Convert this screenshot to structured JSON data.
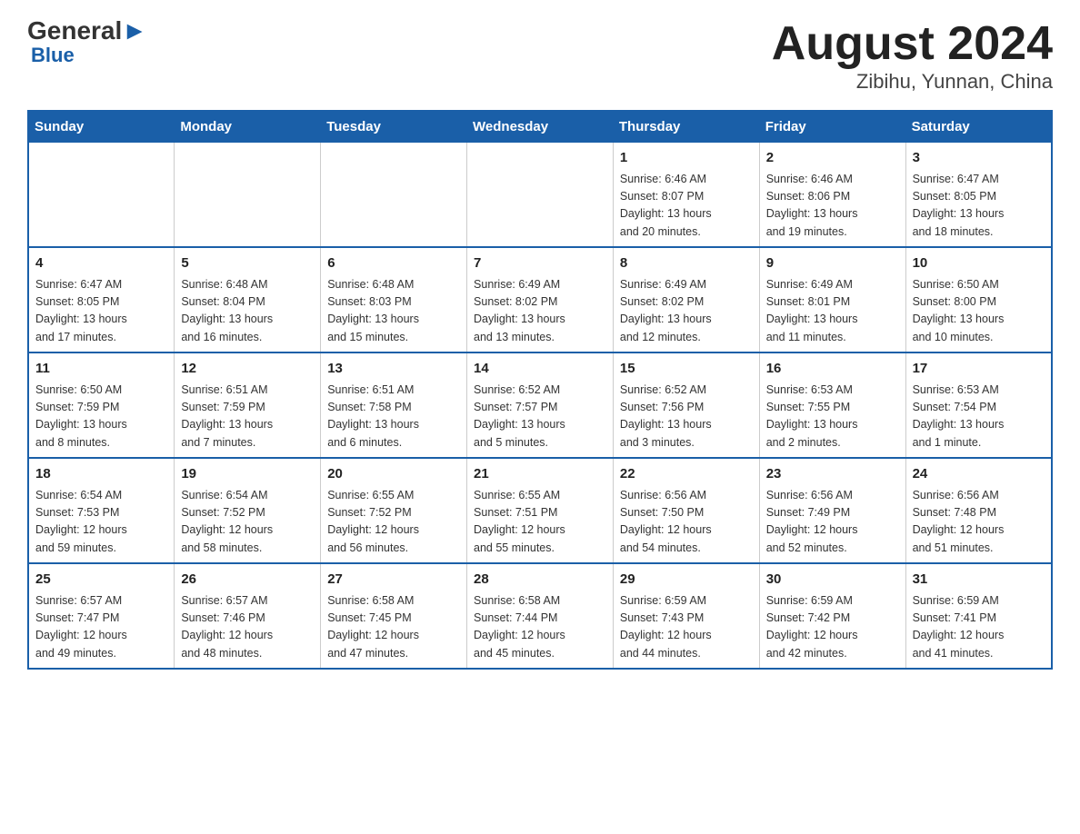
{
  "logo": {
    "general": "General",
    "arrow": "▶",
    "blue": "Blue"
  },
  "title": "August 2024",
  "subtitle": "Zibihu, Yunnan, China",
  "weekdays": [
    "Sunday",
    "Monday",
    "Tuesday",
    "Wednesday",
    "Thursday",
    "Friday",
    "Saturday"
  ],
  "weeks": [
    [
      {
        "day": "",
        "info": ""
      },
      {
        "day": "",
        "info": ""
      },
      {
        "day": "",
        "info": ""
      },
      {
        "day": "",
        "info": ""
      },
      {
        "day": "1",
        "info": "Sunrise: 6:46 AM\nSunset: 8:07 PM\nDaylight: 13 hours\nand 20 minutes."
      },
      {
        "day": "2",
        "info": "Sunrise: 6:46 AM\nSunset: 8:06 PM\nDaylight: 13 hours\nand 19 minutes."
      },
      {
        "day": "3",
        "info": "Sunrise: 6:47 AM\nSunset: 8:05 PM\nDaylight: 13 hours\nand 18 minutes."
      }
    ],
    [
      {
        "day": "4",
        "info": "Sunrise: 6:47 AM\nSunset: 8:05 PM\nDaylight: 13 hours\nand 17 minutes."
      },
      {
        "day": "5",
        "info": "Sunrise: 6:48 AM\nSunset: 8:04 PM\nDaylight: 13 hours\nand 16 minutes."
      },
      {
        "day": "6",
        "info": "Sunrise: 6:48 AM\nSunset: 8:03 PM\nDaylight: 13 hours\nand 15 minutes."
      },
      {
        "day": "7",
        "info": "Sunrise: 6:49 AM\nSunset: 8:02 PM\nDaylight: 13 hours\nand 13 minutes."
      },
      {
        "day": "8",
        "info": "Sunrise: 6:49 AM\nSunset: 8:02 PM\nDaylight: 13 hours\nand 12 minutes."
      },
      {
        "day": "9",
        "info": "Sunrise: 6:49 AM\nSunset: 8:01 PM\nDaylight: 13 hours\nand 11 minutes."
      },
      {
        "day": "10",
        "info": "Sunrise: 6:50 AM\nSunset: 8:00 PM\nDaylight: 13 hours\nand 10 minutes."
      }
    ],
    [
      {
        "day": "11",
        "info": "Sunrise: 6:50 AM\nSunset: 7:59 PM\nDaylight: 13 hours\nand 8 minutes."
      },
      {
        "day": "12",
        "info": "Sunrise: 6:51 AM\nSunset: 7:59 PM\nDaylight: 13 hours\nand 7 minutes."
      },
      {
        "day": "13",
        "info": "Sunrise: 6:51 AM\nSunset: 7:58 PM\nDaylight: 13 hours\nand 6 minutes."
      },
      {
        "day": "14",
        "info": "Sunrise: 6:52 AM\nSunset: 7:57 PM\nDaylight: 13 hours\nand 5 minutes."
      },
      {
        "day": "15",
        "info": "Sunrise: 6:52 AM\nSunset: 7:56 PM\nDaylight: 13 hours\nand 3 minutes."
      },
      {
        "day": "16",
        "info": "Sunrise: 6:53 AM\nSunset: 7:55 PM\nDaylight: 13 hours\nand 2 minutes."
      },
      {
        "day": "17",
        "info": "Sunrise: 6:53 AM\nSunset: 7:54 PM\nDaylight: 13 hours\nand 1 minute."
      }
    ],
    [
      {
        "day": "18",
        "info": "Sunrise: 6:54 AM\nSunset: 7:53 PM\nDaylight: 12 hours\nand 59 minutes."
      },
      {
        "day": "19",
        "info": "Sunrise: 6:54 AM\nSunset: 7:52 PM\nDaylight: 12 hours\nand 58 minutes."
      },
      {
        "day": "20",
        "info": "Sunrise: 6:55 AM\nSunset: 7:52 PM\nDaylight: 12 hours\nand 56 minutes."
      },
      {
        "day": "21",
        "info": "Sunrise: 6:55 AM\nSunset: 7:51 PM\nDaylight: 12 hours\nand 55 minutes."
      },
      {
        "day": "22",
        "info": "Sunrise: 6:56 AM\nSunset: 7:50 PM\nDaylight: 12 hours\nand 54 minutes."
      },
      {
        "day": "23",
        "info": "Sunrise: 6:56 AM\nSunset: 7:49 PM\nDaylight: 12 hours\nand 52 minutes."
      },
      {
        "day": "24",
        "info": "Sunrise: 6:56 AM\nSunset: 7:48 PM\nDaylight: 12 hours\nand 51 minutes."
      }
    ],
    [
      {
        "day": "25",
        "info": "Sunrise: 6:57 AM\nSunset: 7:47 PM\nDaylight: 12 hours\nand 49 minutes."
      },
      {
        "day": "26",
        "info": "Sunrise: 6:57 AM\nSunset: 7:46 PM\nDaylight: 12 hours\nand 48 minutes."
      },
      {
        "day": "27",
        "info": "Sunrise: 6:58 AM\nSunset: 7:45 PM\nDaylight: 12 hours\nand 47 minutes."
      },
      {
        "day": "28",
        "info": "Sunrise: 6:58 AM\nSunset: 7:44 PM\nDaylight: 12 hours\nand 45 minutes."
      },
      {
        "day": "29",
        "info": "Sunrise: 6:59 AM\nSunset: 7:43 PM\nDaylight: 12 hours\nand 44 minutes."
      },
      {
        "day": "30",
        "info": "Sunrise: 6:59 AM\nSunset: 7:42 PM\nDaylight: 12 hours\nand 42 minutes."
      },
      {
        "day": "31",
        "info": "Sunrise: 6:59 AM\nSunset: 7:41 PM\nDaylight: 12 hours\nand 41 minutes."
      }
    ]
  ]
}
